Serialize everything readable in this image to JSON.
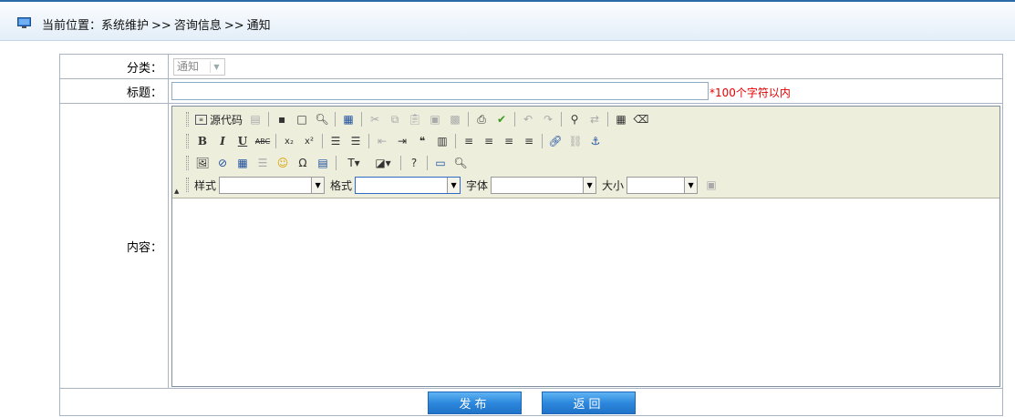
{
  "breadcrumb": {
    "prefix": "当前位置：",
    "items": [
      "系统维护",
      "咨询信息",
      "通知"
    ],
    "separator": ">>"
  },
  "form": {
    "category_label": "分类：",
    "category_value": "通知",
    "title_label": "标题：",
    "title_value": "",
    "title_hint": "*100个字符以内",
    "content_label": "内容："
  },
  "editor": {
    "source_label": "源代码",
    "style_label": "样式",
    "format_label": "格式",
    "font_label": "字体",
    "size_label": "大小",
    "style_value": "",
    "format_value": "",
    "font_value": "",
    "size_value": ""
  },
  "buttons": {
    "publish": "发布",
    "back": "返回"
  },
  "colors": {
    "hint": "#e30000",
    "button": "#2d88dd",
    "toolbar": "#eeeedd"
  }
}
